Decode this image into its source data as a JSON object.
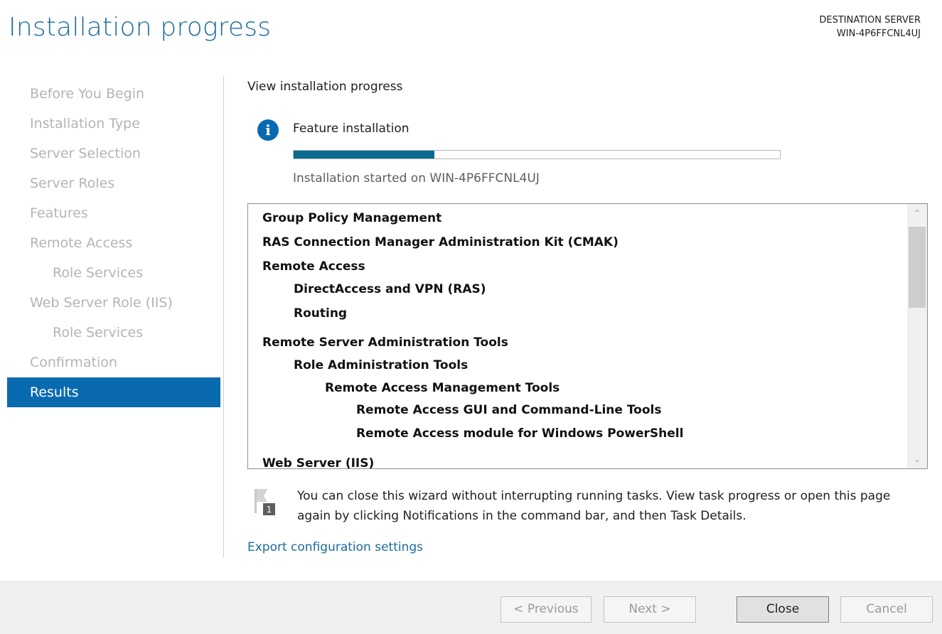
{
  "header": {
    "title": "Installation progress",
    "destination_label": "DESTINATION SERVER",
    "destination_server": "WIN-4P6FFCNL4UJ"
  },
  "nav": {
    "items": [
      {
        "label": "Before You Begin",
        "level": 0,
        "active": false
      },
      {
        "label": "Installation Type",
        "level": 0,
        "active": false
      },
      {
        "label": "Server Selection",
        "level": 0,
        "active": false
      },
      {
        "label": "Server Roles",
        "level": 0,
        "active": false
      },
      {
        "label": "Features",
        "level": 0,
        "active": false
      },
      {
        "label": "Remote Access",
        "level": 0,
        "active": false
      },
      {
        "label": "Role Services",
        "level": 1,
        "active": false
      },
      {
        "label": "Web Server Role (IIS)",
        "level": 0,
        "active": false
      },
      {
        "label": "Role Services",
        "level": 1,
        "active": false
      },
      {
        "label": "Confirmation",
        "level": 0,
        "active": false
      },
      {
        "label": "Results",
        "level": 0,
        "active": true
      }
    ]
  },
  "main": {
    "section_title": "View installation progress",
    "feature_label": "Feature installation",
    "progress_fraction": 0.29,
    "started_text": "Installation started on WIN-4P6FFCNL4UJ",
    "features": [
      {
        "label": "Group Policy Management",
        "level": 0
      },
      {
        "label": "RAS Connection Manager Administration Kit (CMAK)",
        "level": 0
      },
      {
        "label": "Remote Access",
        "level": 0
      },
      {
        "label": "DirectAccess and VPN (RAS)",
        "level": 1
      },
      {
        "label": "Routing",
        "level": 1
      },
      {
        "label": "Remote Server Administration Tools",
        "level": 0
      },
      {
        "label": "Role Administration Tools",
        "level": 1
      },
      {
        "label": "Remote Access Management Tools",
        "level": 2
      },
      {
        "label": "Remote Access GUI and Command-Line Tools",
        "level": 3
      },
      {
        "label": "Remote Access module for Windows PowerShell",
        "level": 3
      },
      {
        "label": "Web Server (IIS)",
        "level": 0
      }
    ],
    "notice_text": "You can close this wizard without interrupting running tasks. View task progress or open this page again by clicking Notifications in the command bar, and then Task Details.",
    "notification_count": "1",
    "export_link": "Export configuration settings"
  },
  "footer": {
    "previous_label": "< Previous",
    "next_label": "Next >",
    "close_label": "Close",
    "cancel_label": "Cancel"
  },
  "colors": {
    "accent": "#0a6ab0",
    "progress": "#0a6b8f",
    "title": "#1c6b9c"
  }
}
